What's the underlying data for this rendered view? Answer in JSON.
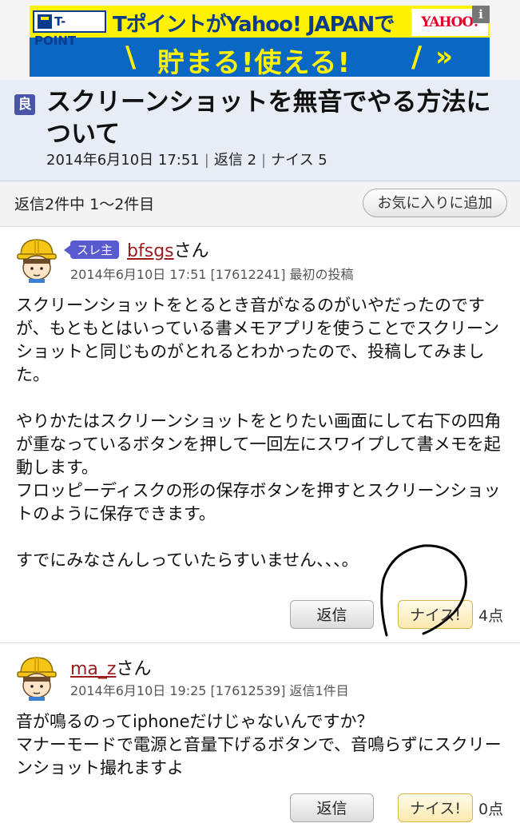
{
  "banner": {
    "brand_logo": "T-POINT",
    "headline": "TポイントがYahoo! JAPANで",
    "yahoo_logo": "YAHOO!",
    "info_badge": "i",
    "slash_left": "\\",
    "subheadline": "貯まる!使える!",
    "slash_right": "/",
    "chevron": "»",
    "colors": {
      "yellow": "#fff200",
      "blue": "#0b67c4",
      "navy": "#0b3b8c"
    }
  },
  "thread": {
    "badge": "良",
    "title": "スクリーンショットを無音でやる方法について",
    "date": "2014年6月10日 17:51",
    "replies": "返信 2",
    "nice": "ナイス 5",
    "separator": "|"
  },
  "toolbar": {
    "count_text": "返信2件中 1～2件目",
    "favorite_button": "お気に入りに追加"
  },
  "posts": [
    {
      "owner_badge": "スレ主",
      "author": "bfsgs",
      "honorific": "さん",
      "meta": "2014年6月10日 17:51 [17612241] 最初の投稿",
      "body": "スクリーンショットをとるとき音がなるのがいやだったのですが、もともとはいっている書メモアプリを使うことでスクリーンショットと同じものがとれるとわかったので、投稿してみました。\n\nやりかたはスクリーンショットをとりたい画面にして右下の四角が重なっているボタンを押して一回左にスワイプして書メモを起動します。\nフロッピーディスクの形の保存ボタンを押すとスクリーンショットのように保存できます。\n\nすでにみなさんしっていたらすいません、、、。",
      "reply_button": "返信",
      "nice_button": "ナイス!",
      "nice_count": "4点"
    },
    {
      "author": "ma_z",
      "honorific": "さん",
      "meta": "2014年6月10日 19:25 [17612539] 返信1件目",
      "body": "音が鳴るのってiphoneだけじゃないんですか？\nマナーモードで電源と音量下げるボタンで、音鳴らずにスクリーンショット撮れますよ",
      "reply_button": "返信",
      "nice_button": "ナイス!",
      "nice_count": "0点"
    }
  ],
  "icons": [
    "avatar-hardhat-icon",
    "info-icon",
    "good-badge-icon"
  ]
}
